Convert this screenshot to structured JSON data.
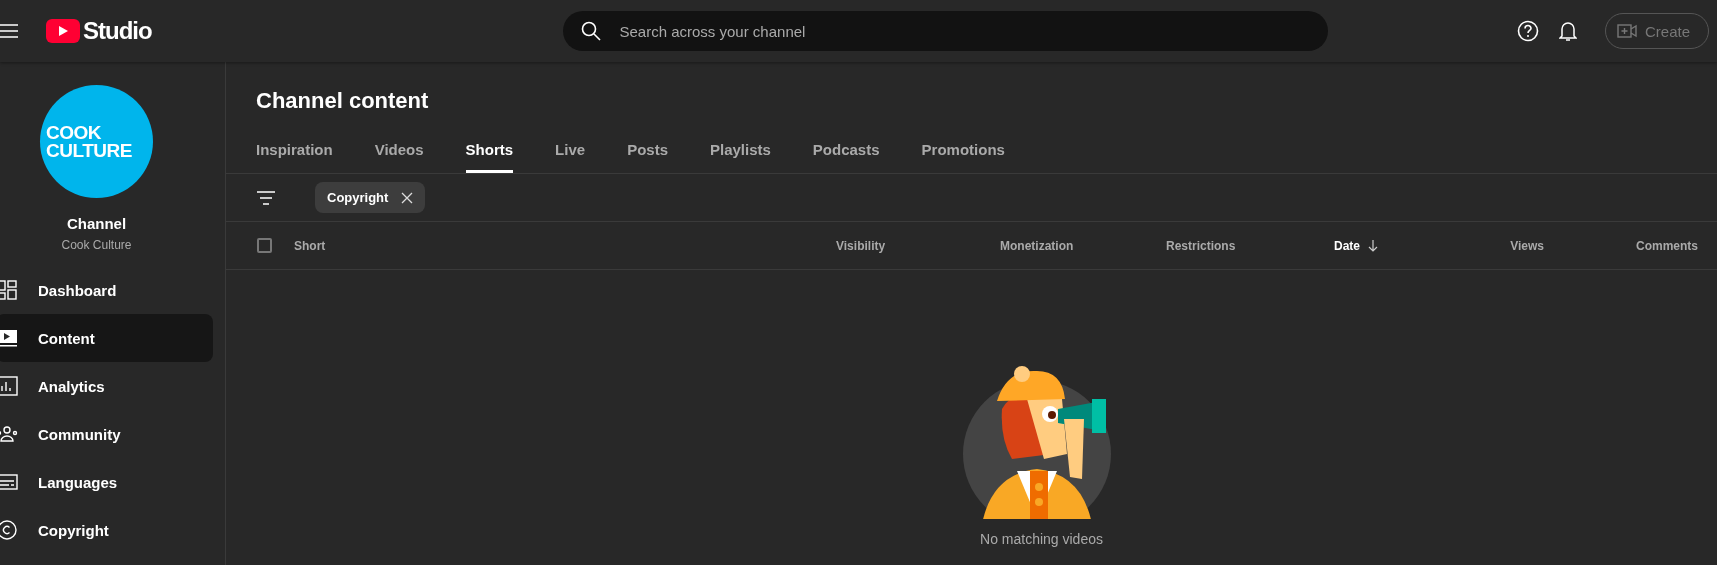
{
  "header": {
    "logo_text": "Studio",
    "search": {
      "placeholder": "Search across your channel"
    },
    "create_button": {
      "label": "Create",
      "disabled": true
    }
  },
  "sidebar": {
    "avatar_text": [
      "COOK",
      "CULTURE"
    ],
    "channel_label": "Channel",
    "channel_name": "Cook Culture",
    "items": [
      {
        "label": "Dashboard",
        "selected": false
      },
      {
        "label": "Content",
        "selected": true
      },
      {
        "label": "Analytics",
        "selected": false
      },
      {
        "label": "Community",
        "selected": false
      },
      {
        "label": "Languages",
        "selected": false
      },
      {
        "label": "Copyright",
        "selected": false
      }
    ]
  },
  "page": {
    "title": "Channel content",
    "tabs": [
      {
        "label": "Inspiration",
        "selected": false
      },
      {
        "label": "Videos",
        "selected": false
      },
      {
        "label": "Shorts",
        "selected": true
      },
      {
        "label": "Live",
        "selected": false
      },
      {
        "label": "Posts",
        "selected": false
      },
      {
        "label": "Playlists",
        "selected": false
      },
      {
        "label": "Podcasts",
        "selected": false
      },
      {
        "label": "Promotions",
        "selected": false
      }
    ],
    "filter_chip": "Copyright",
    "table": {
      "select_all_checked": false,
      "columns": [
        {
          "label": "Short",
          "sorted": false
        },
        {
          "label": "Visibility",
          "sorted": false
        },
        {
          "label": "Monetization",
          "sorted": false
        },
        {
          "label": "Restrictions",
          "sorted": false
        },
        {
          "label": "Date",
          "sorted": true
        },
        {
          "label": "Views",
          "sorted": false
        },
        {
          "label": "Comments",
          "sorted": false
        }
      ]
    },
    "empty_message": "No matching videos"
  }
}
